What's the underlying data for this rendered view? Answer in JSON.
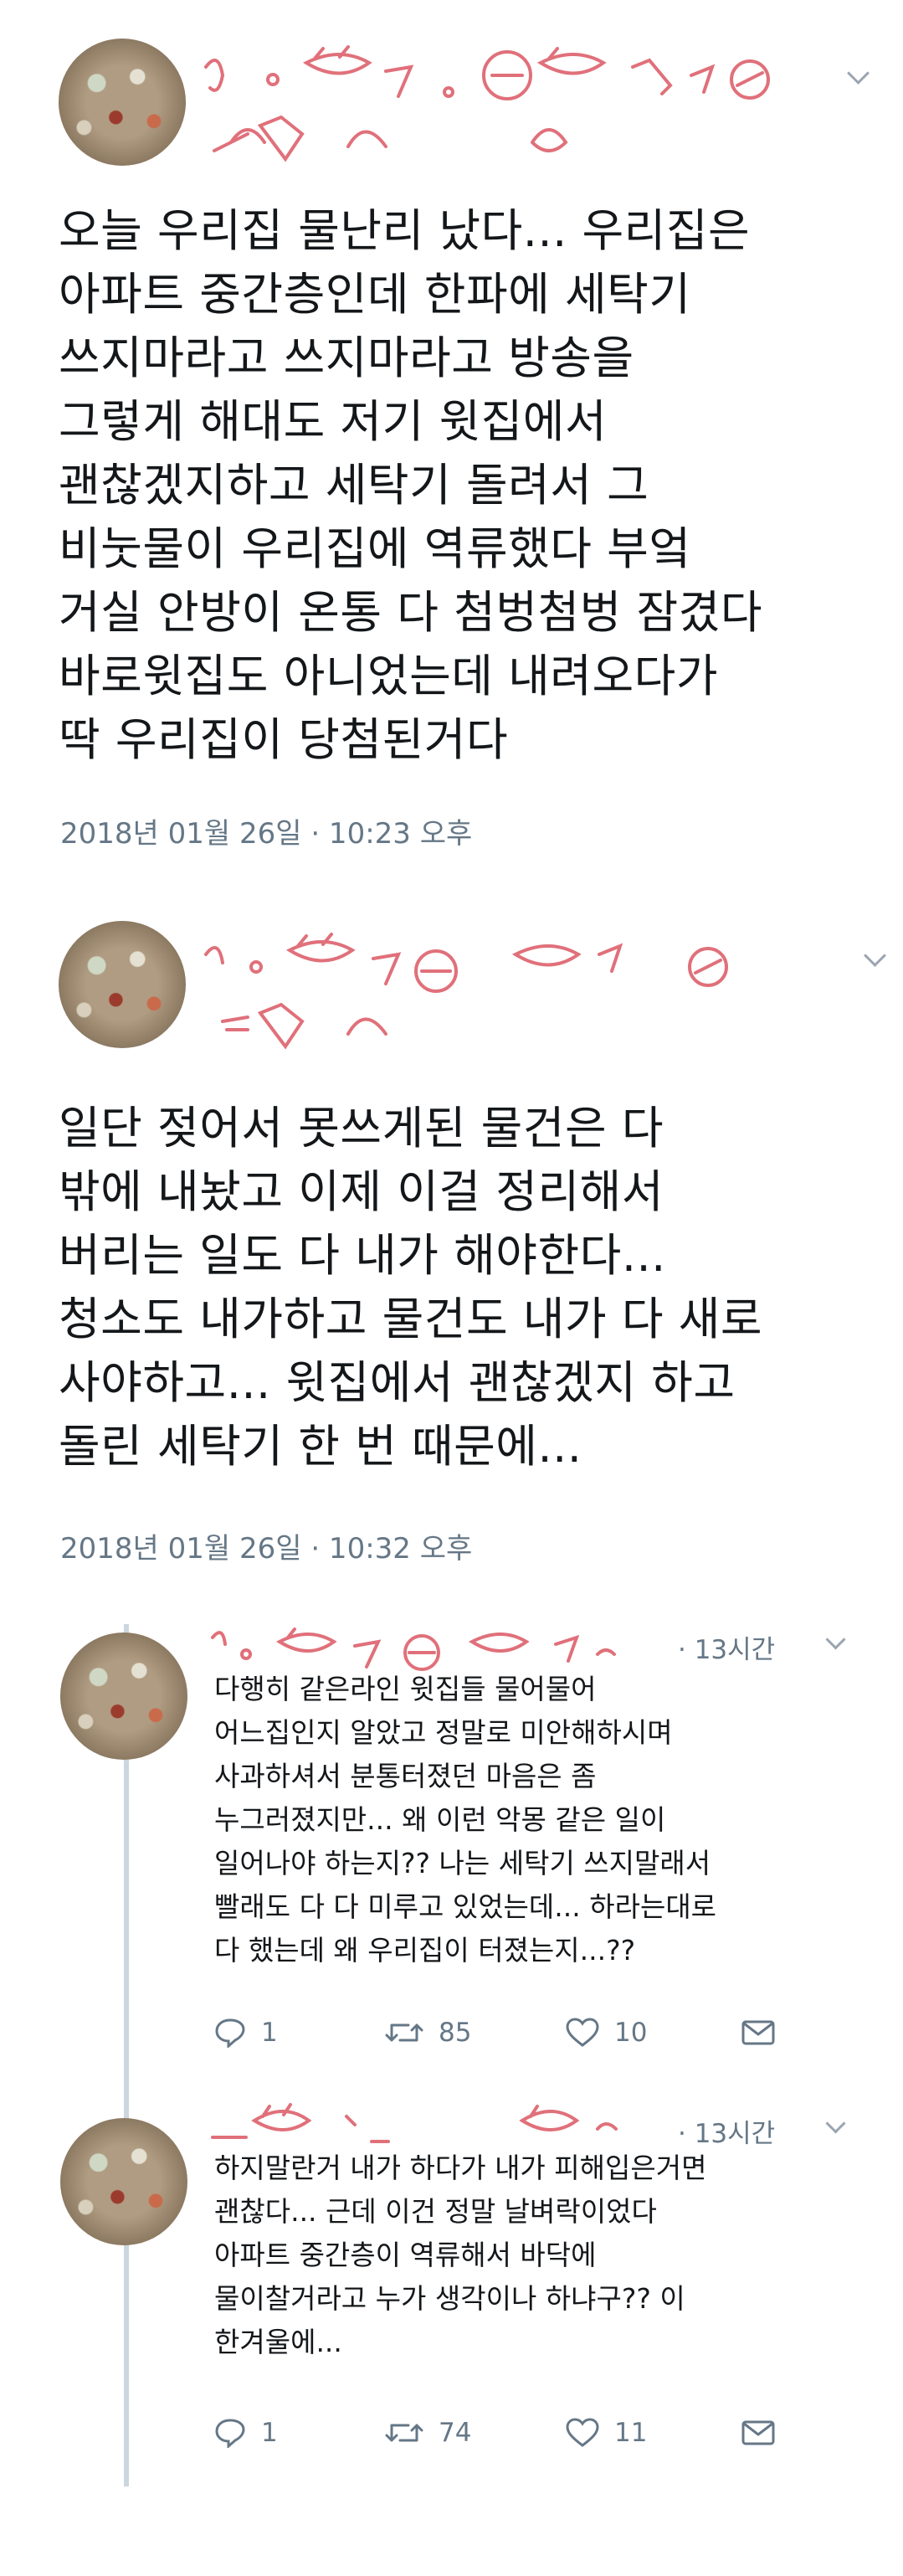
{
  "tweets": [
    {
      "text": "오늘 우리집 물난리 났다... 우리집은\n아파트 중간층인데 한파에 세탁기\n쓰지마라고 쓰지마라고 방송을\n그렇게 해대도 저기 윗집에서\n괜찮겠지하고 세탁기 돌려서 그\n비눗물이 우리집에 역류했다 부엌\n거실 안방이 온통 다 첨벙첨벙 잠겼다\n바로윗집도 아니었는데 내려오다가\n딱 우리집이 당첨된거다",
      "timestamp": "2018년 01월 26일 · 10:23 오후"
    },
    {
      "text": "일단 젖어서 못쓰게된 물건은 다\n밖에 내놨고 이제 이걸 정리해서\n버리는 일도 다 내가 해야한다...\n청소도 내가하고 물건도 내가 다 새로\n사야하고... 윗집에서 괜찮겠지 하고\n돌린 세탁기 한 번 때문에...",
      "timestamp": "2018년 01월 26일 · 10:32 오후"
    }
  ],
  "replies": [
    {
      "time": "· 13시간",
      "text": "다행히 같은라인 윗집들 물어물어\n어느집인지 알았고 정말로 미안해하시며\n사과하셔서 분통터졌던 마음은 좀\n누그러졌지만... 왜 이런 악몽 같은 일이\n일어나야 하는지?? 나는 세탁기 쓰지말래서\n빨래도 다 다 미루고 있었는데... 하라는대로\n다 했는데 왜 우리집이 터졌는지...??",
      "replies_count": "1",
      "retweets": "85",
      "likes": "10"
    },
    {
      "time": "· 13시간",
      "text": "하지말란거 내가 하다가 내가 피해입은거면\n괜찮다... 근데 이건 정말 날벼락이었다\n아파트 중간층이 역류해서 바닥에\n물이찰거라고 누가 생각이나 하냐구?? 이\n한겨울에...",
      "replies_count": "1",
      "retweets": "74",
      "likes": "11"
    }
  ],
  "colors": {
    "text": "#14171a",
    "secondary": "#657786",
    "thread_line": "#ccd6dd",
    "scribble": "#e0707a"
  },
  "icons": [
    "chevron-down-icon",
    "reply-icon",
    "retweet-icon",
    "like-icon",
    "dm-icon"
  ]
}
